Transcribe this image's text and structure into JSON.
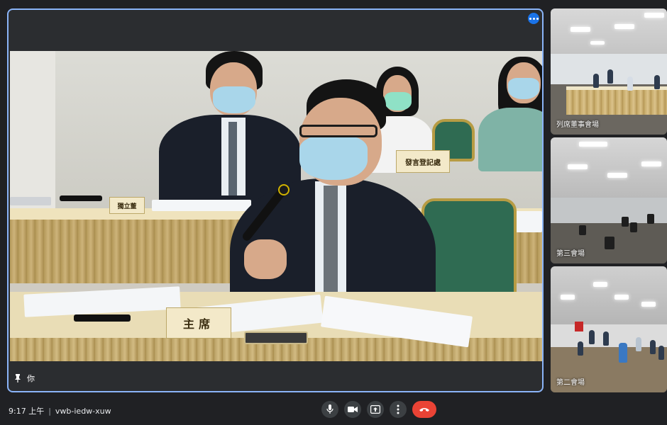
{
  "main_tile": {
    "participant_name": "你",
    "nameplates": {
      "chairman": "主席",
      "left_person": "獨立董",
      "back_person": "發言登記處"
    }
  },
  "side_tiles": [
    {
      "label": "列席董事會場"
    },
    {
      "label": "第三會場"
    },
    {
      "label": "第二會場"
    }
  ],
  "bottom_bar": {
    "time": "9:17 上午",
    "separator": "|",
    "meeting_code": "vwb-iedw-xuw"
  },
  "controls": [
    {
      "name": "microphone"
    },
    {
      "name": "camera"
    },
    {
      "name": "present-screen"
    },
    {
      "name": "more-options"
    },
    {
      "name": "leave-call"
    }
  ],
  "colors": {
    "background": "#202124",
    "active_speaker_border": "#8ab4f8",
    "end_call": "#ea4335",
    "control_bg": "#3c4043"
  }
}
